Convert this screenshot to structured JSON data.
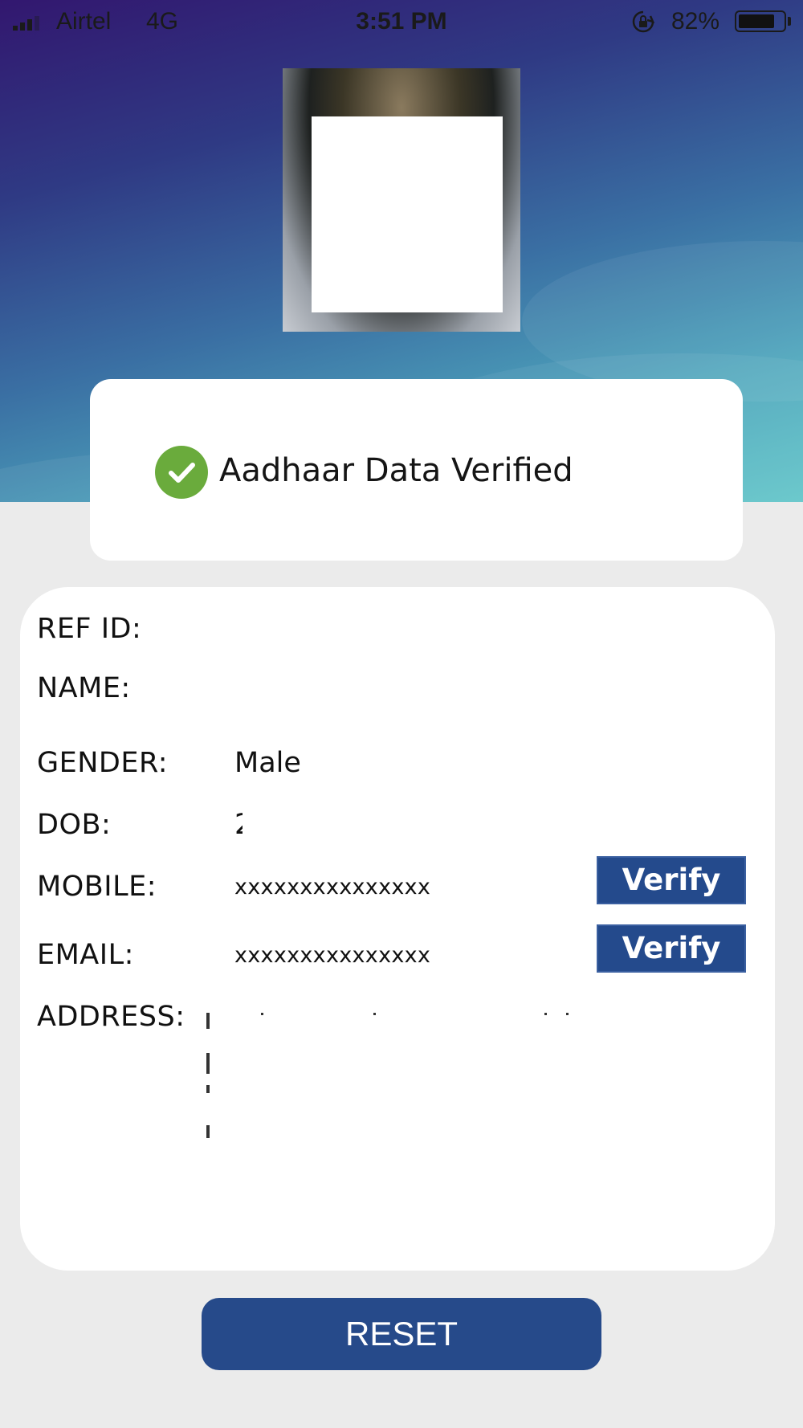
{
  "status_bar": {
    "carrier": "Airtel",
    "network": "4G",
    "time": "3:51 PM",
    "battery_percent": "82%",
    "battery_level": 0.82,
    "icons": [
      "signal-icon",
      "orientation-lock-icon",
      "battery-icon"
    ]
  },
  "profile": {
    "photo": "masked-face-photo"
  },
  "verification": {
    "message": "Aadhaar Data Verified",
    "icon": "check-circle-icon",
    "color": "#6aab3c"
  },
  "details": {
    "ref_id_label": "REF ID:",
    "name_label": "NAME:",
    "gender_label": "GENDER:",
    "gender_value": "Male",
    "dob_label": "DOB:",
    "dob_value": "2",
    "mobile_label": "MOBILE:",
    "mobile_value": "xxxxxxxxxxxxxxx",
    "mobile_verify_label": "Verify",
    "email_label": "EMAIL:",
    "email_value": "xxxxxxxxxxxxxxx",
    "email_verify_label": "Verify",
    "address_label": "ADDRESS:"
  },
  "actions": {
    "reset_label": "RESET"
  },
  "colors": {
    "primary_button": "#244a8c",
    "success": "#6aab3c",
    "page_background": "#ebebeb"
  }
}
